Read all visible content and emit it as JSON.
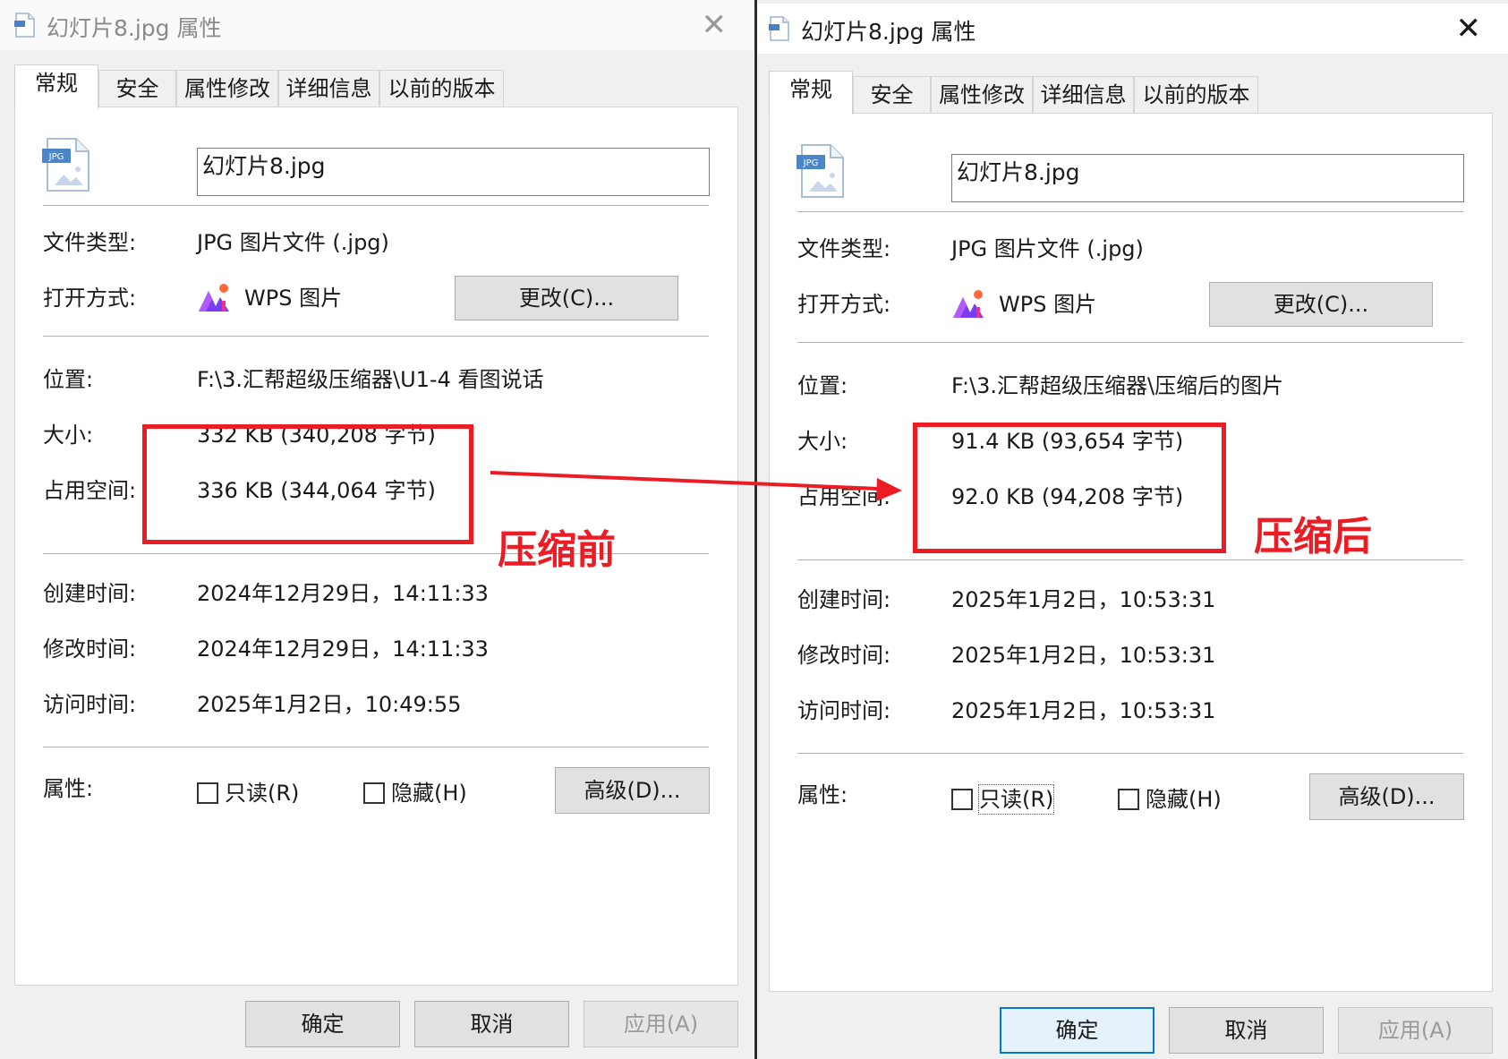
{
  "left": {
    "title": "幻灯片8.jpg 属性",
    "tabs": [
      "常规",
      "安全",
      "属性修改",
      "详细信息",
      "以前的版本"
    ],
    "file_icon_label": "JPG",
    "filename": "幻灯片8.jpg",
    "labels": {
      "type": "文件类型:",
      "open_with": "打开方式:",
      "location": "位置:",
      "size": "大小:",
      "size_on_disk": "占用空间:",
      "created": "创建时间:",
      "modified": "修改时间:",
      "accessed": "访问时间:",
      "attributes": "属性:"
    },
    "values": {
      "type": "JPG 图片文件 (.jpg)",
      "open_with": "WPS 图片",
      "location": "F:\\3.汇帮超级压缩器\\U1-4 看图说话",
      "size": "332 KB (340,208 字节)",
      "size_on_disk": "336 KB (344,064 字节)",
      "created": "2024年12月29日，14:11:33",
      "modified": "2024年12月29日，14:11:33",
      "accessed": "2025年1月2日，10:49:55"
    },
    "buttons": {
      "change": "更改(C)...",
      "advanced": "高级(D)...",
      "ok": "确定",
      "cancel": "取消",
      "apply": "应用(A)"
    },
    "checkboxes": {
      "readonly": "只读(R)",
      "hidden": "隐藏(H)"
    },
    "annotation": "压缩前"
  },
  "right": {
    "title": "幻灯片8.jpg 属性",
    "tabs": [
      "常规",
      "安全",
      "属性修改",
      "详细信息",
      "以前的版本"
    ],
    "file_icon_label": "JPG",
    "filename": "幻灯片8.jpg",
    "labels": {
      "type": "文件类型:",
      "open_with": "打开方式:",
      "location": "位置:",
      "size": "大小:",
      "size_on_disk": "占用空间:",
      "created": "创建时间:",
      "modified": "修改时间:",
      "accessed": "访问时间:",
      "attributes": "属性:"
    },
    "values": {
      "type": "JPG 图片文件 (.jpg)",
      "open_with": "WPS 图片",
      "location": "F:\\3.汇帮超级压缩器\\压缩后的图片",
      "size": "91.4 KB (93,654 字节)",
      "size_on_disk": "92.0 KB (94,208 字节)",
      "created": "2025年1月2日，10:53:31",
      "modified": "2025年1月2日，10:53:31",
      "accessed": "2025年1月2日，10:53:31"
    },
    "buttons": {
      "change": "更改(C)...",
      "advanced": "高级(D)...",
      "ok": "确定",
      "cancel": "取消",
      "apply": "应用(A)"
    },
    "checkboxes": {
      "readonly": "只读(R)",
      "hidden": "隐藏(H)"
    },
    "annotation": "压缩后"
  },
  "colors": {
    "annotation_red": "#ec1c24",
    "primary_button_border": "#0078d7",
    "dialog_bg": "#f0f0f0"
  }
}
